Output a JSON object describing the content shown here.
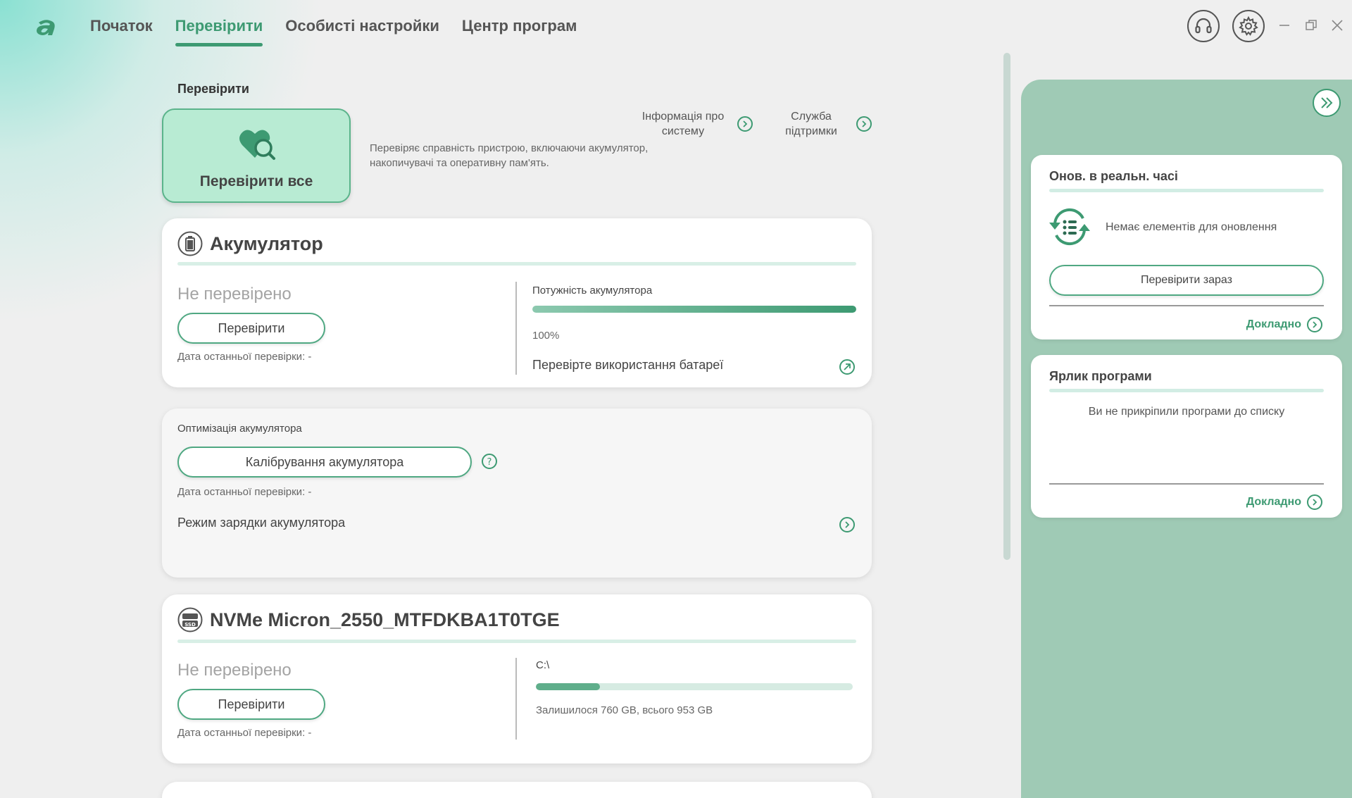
{
  "nav": {
    "items": [
      {
        "label": "Початок",
        "active": false
      },
      {
        "label": "Перевірити",
        "active": true
      },
      {
        "label": "Особисті настройки",
        "active": false
      },
      {
        "label": "Центр програм",
        "active": false
      }
    ],
    "icons": [
      "headset-icon",
      "gear-icon"
    ],
    "window_controls": [
      "minimize-icon",
      "restore-icon",
      "close-icon"
    ]
  },
  "colors": {
    "accent": "#3d9a72",
    "panel": "#9fcab5",
    "check_all_bg": "#b8ebd3"
  },
  "check": {
    "section_title": "Перевірити",
    "check_all_label": "Перевірити все",
    "description": "Перевіряє справність пристрою, включаючи акумулятор, накопичувачі та оперативну пам'ять.",
    "links": {
      "system_info": "Інформація про систему",
      "support": "Служба підтримки"
    }
  },
  "battery": {
    "title": "Акумулятор",
    "status": "Не перевірено",
    "check_button": "Перевірити",
    "last_check": "Дата останньої перевірки: -",
    "capacity_label": "Потужність акумулятора",
    "capacity_percent": 100,
    "capacity_text": "100%",
    "usage_link": "Перевірте використання батареї"
  },
  "optimization": {
    "title": "Оптимізація акумулятора",
    "calibrate_button": "Калібрування акумулятора",
    "last_check": "Дата останньої перевірки: -",
    "charge_mode": "Режим зарядки акумулятора"
  },
  "ssd": {
    "badge": "SSD",
    "title": "NVMe Micron_2550_MTFDKBA1T0TGE",
    "status": "Не перевірено",
    "check_button": "Перевірити",
    "last_check": "Дата останньої перевірки: -",
    "drive_label": "C:\\",
    "used_fraction": 0.203,
    "space_text": "Залишилося 760 GB, всього 953 GB"
  },
  "right_panel": {
    "updates": {
      "title": "Онов. в реальн. часі",
      "no_items": "Немає елементів для оновлення",
      "check_now": "Перевірити зараз",
      "more": "Докладно"
    },
    "shortcuts": {
      "title": "Ярлик програми",
      "empty": "Ви не прикріпили програми до списку",
      "more": "Докладно"
    }
  }
}
